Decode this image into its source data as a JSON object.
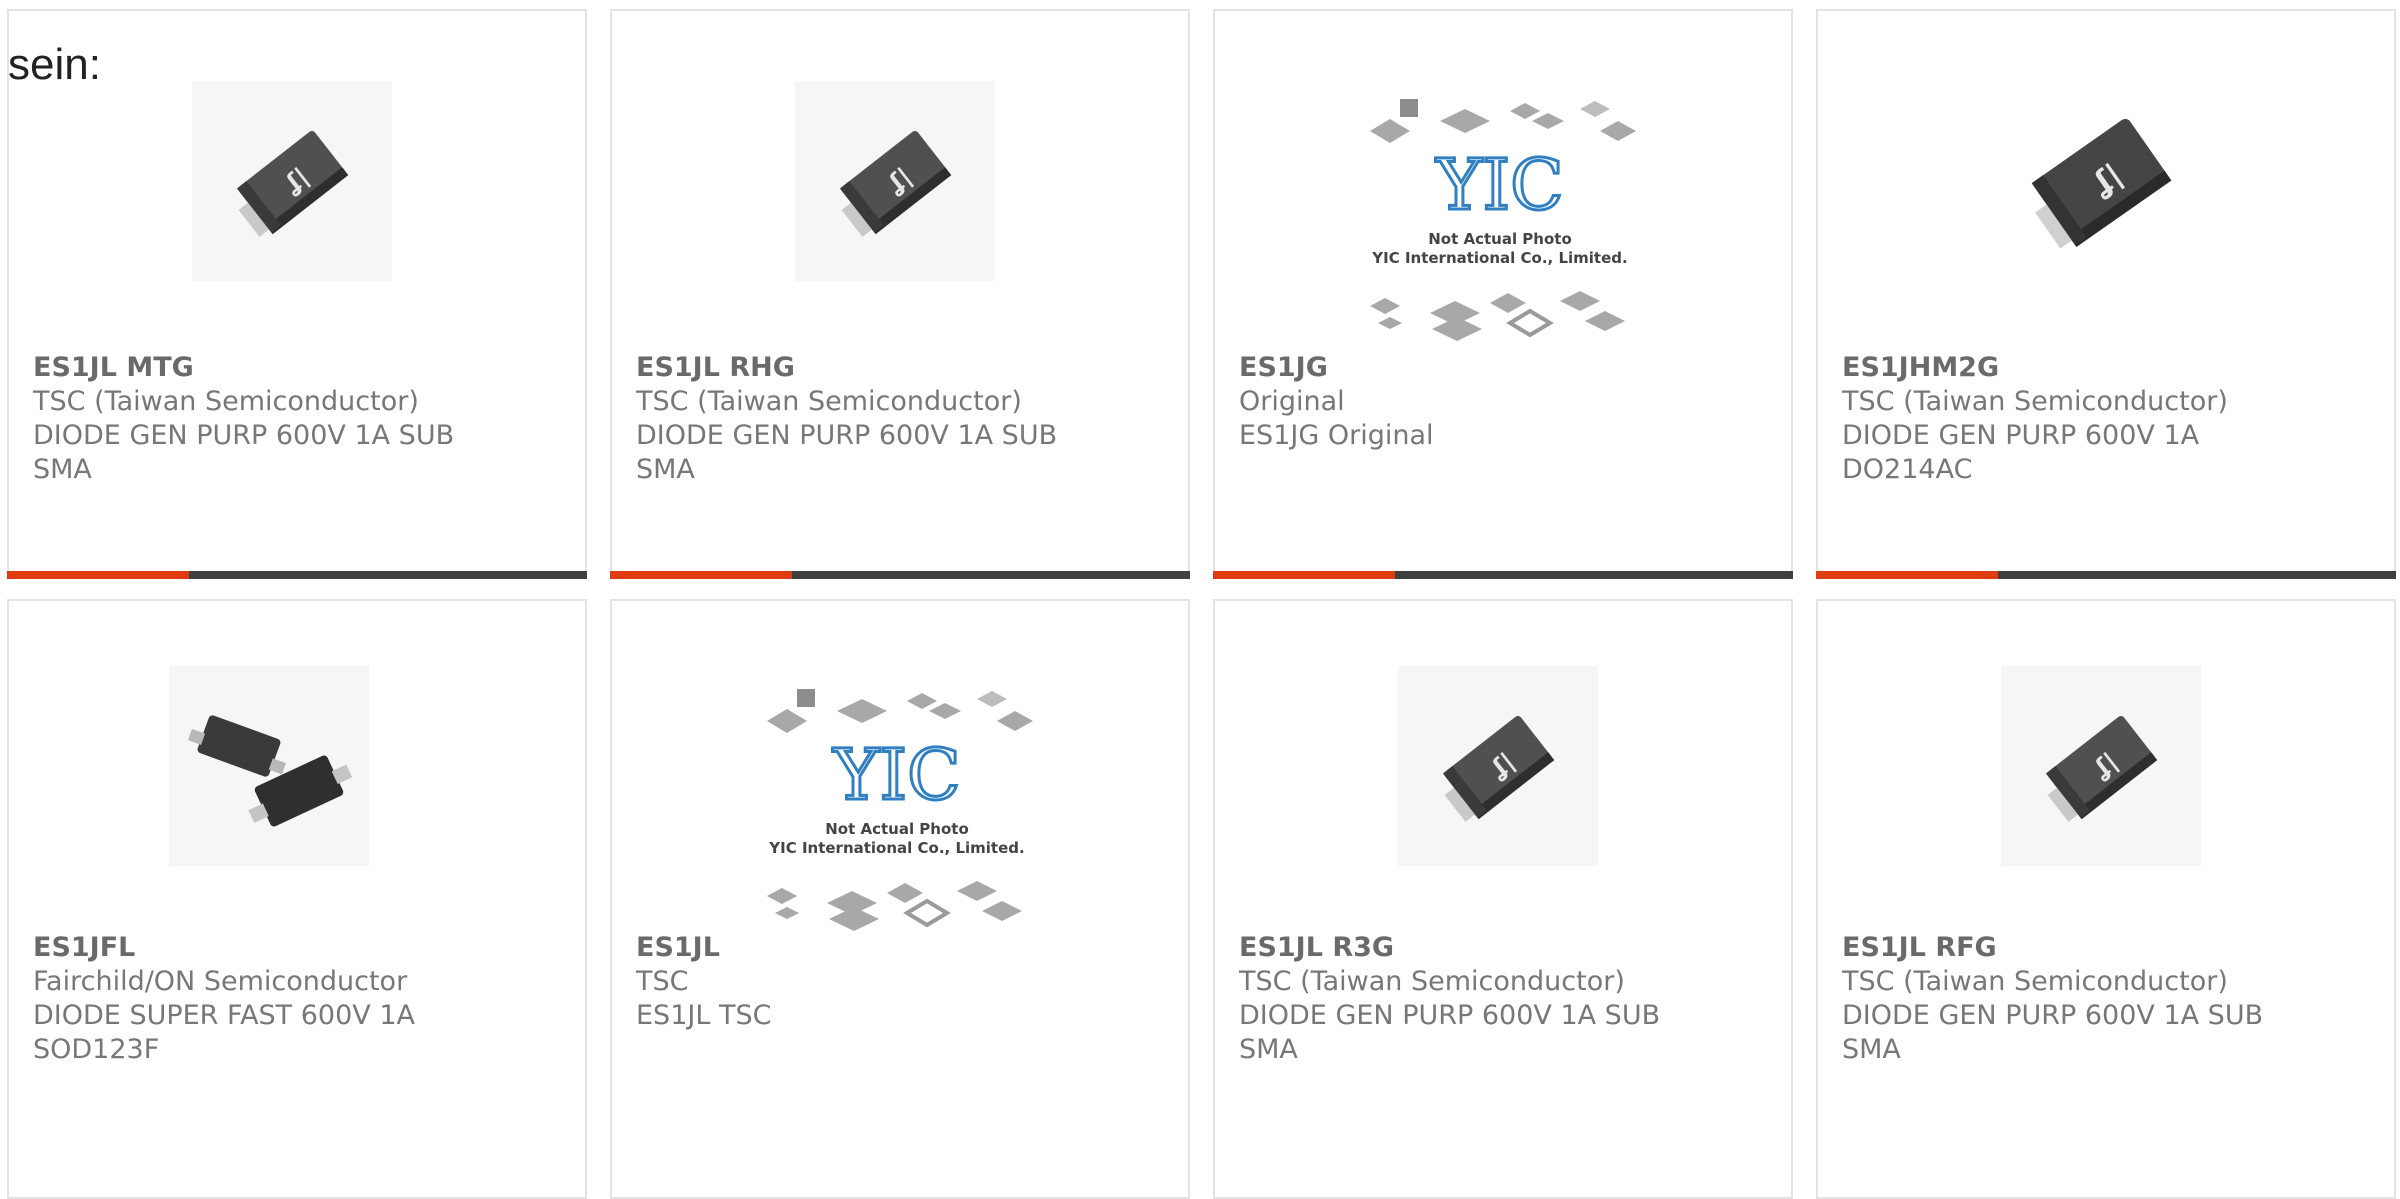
{
  "intro_text": "sein:",
  "colors": {
    "accent_red": "#e03c12",
    "accent_dark": "#3f3f3f",
    "card_border": "#e3e3e3",
    "text": "#777777"
  },
  "placeholder_lines": [
    "Not Actual Photo",
    "YIC International Co., Limited."
  ],
  "placeholder_logo": "YIC",
  "products": [
    {
      "part": "ES1JL MTG",
      "maker": "TSC (Taiwan Semiconductor)",
      "desc1": "DIODE GEN PURP 600V 1A SUB",
      "desc2": "SMA",
      "image": "sma-diode-icon"
    },
    {
      "part": "ES1JL RHG",
      "maker": "TSC (Taiwan Semiconductor)",
      "desc1": "DIODE GEN PURP 600V 1A SUB",
      "desc2": "SMA",
      "image": "sma-diode-icon"
    },
    {
      "part": "ES1JG",
      "maker": "Original",
      "desc1": "ES1JG Original",
      "desc2": "",
      "image": "not-actual-photo-icon"
    },
    {
      "part": "ES1JHM2G",
      "maker": "TSC (Taiwan Semiconductor)",
      "desc1": "DIODE GEN PURP 600V 1A",
      "desc2": "DO214AC",
      "image": "do214ac-diode-icon"
    },
    {
      "part": "ES1JFL",
      "maker": "Fairchild/ON Semiconductor",
      "desc1": "DIODE SUPER FAST 600V 1A",
      "desc2": "SOD123F",
      "image": "sod123f-diode-icon"
    },
    {
      "part": "ES1JL",
      "maker": "TSC",
      "desc1": "ES1JL TSC",
      "desc2": "",
      "image": "not-actual-photo-icon"
    },
    {
      "part": "ES1JL R3G",
      "maker": "TSC (Taiwan Semiconductor)",
      "desc1": "DIODE GEN PURP 600V 1A SUB",
      "desc2": "SMA",
      "image": "sma-diode-icon"
    },
    {
      "part": "ES1JL RFG",
      "maker": "TSC (Taiwan Semiconductor)",
      "desc1": "DIODE GEN PURP 600V 1A SUB",
      "desc2": "SMA",
      "image": "sma-diode-icon"
    }
  ]
}
